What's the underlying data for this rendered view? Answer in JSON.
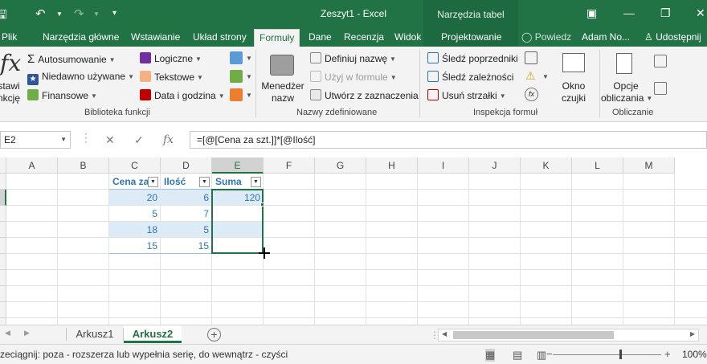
{
  "title": "Zeszyt1 - Excel",
  "context_title": "Narzędzia tabel",
  "tabs": [
    "Plik",
    "Narzędzia główne",
    "Wstawianie",
    "Układ strony",
    "Formuły",
    "Dane",
    "Recenzja",
    "Widok",
    "Projektowanie"
  ],
  "tell_me": "Powiedz",
  "user": "Adam No...",
  "share": "Udostępnij",
  "ribbon": {
    "insert_function": [
      "stawi",
      "nkcję"
    ],
    "autosum": "Autosumowanie",
    "recent": "Niedawno używane",
    "financial": "Finansowe",
    "logical": "Logiczne",
    "text": "Tekstowe",
    "datetime": "Data i godzina",
    "group_library": "Biblioteka funkcji",
    "name_manager": [
      "Menedżer",
      "nazw"
    ],
    "define_name": "Definiuj nazwę",
    "use_in_formula": "Użyj w formule",
    "create_from_sel": "Utwórz z zaznaczenia",
    "group_names": "Nazwy zdefiniowane",
    "trace_prec": "Śledź poprzedniki",
    "trace_dep": "Śledź zależności",
    "remove_arrows": "Usuń strzałki",
    "group_audit": "Inspekcja formuł",
    "watch": [
      "Okno",
      "czujki"
    ],
    "calc_options": [
      "Opcje",
      "obliczania"
    ],
    "group_calc": "Obliczanie"
  },
  "namebox": "E2",
  "formula": "=[@[Cena za szt.]]*[@Ilość]",
  "columns": [
    "A",
    "B",
    "C",
    "D",
    "E",
    "F",
    "G",
    "H",
    "I",
    "J",
    "K",
    "L",
    "M"
  ],
  "table": {
    "headers": [
      "Cena za szt.",
      "Ilość",
      "Suma"
    ],
    "rows": [
      {
        "c": "20",
        "d": "6",
        "e": "120"
      },
      {
        "c": "5",
        "d": "7",
        "e": ""
      },
      {
        "c": "18",
        "d": "5",
        "e": ""
      },
      {
        "c": "15",
        "d": "15",
        "e": ""
      }
    ]
  },
  "sheets": [
    "Arkusz1",
    "Arkusz2"
  ],
  "active_sheet": "Arkusz2",
  "status": "zeciągnij: poza - rozszerza lub wypełnia serię, do wewnątrz - czyści",
  "zoom": "100%",
  "colors": {
    "accent": "#217346",
    "table_text": "#2f75b5",
    "band": "#ddebf7"
  }
}
